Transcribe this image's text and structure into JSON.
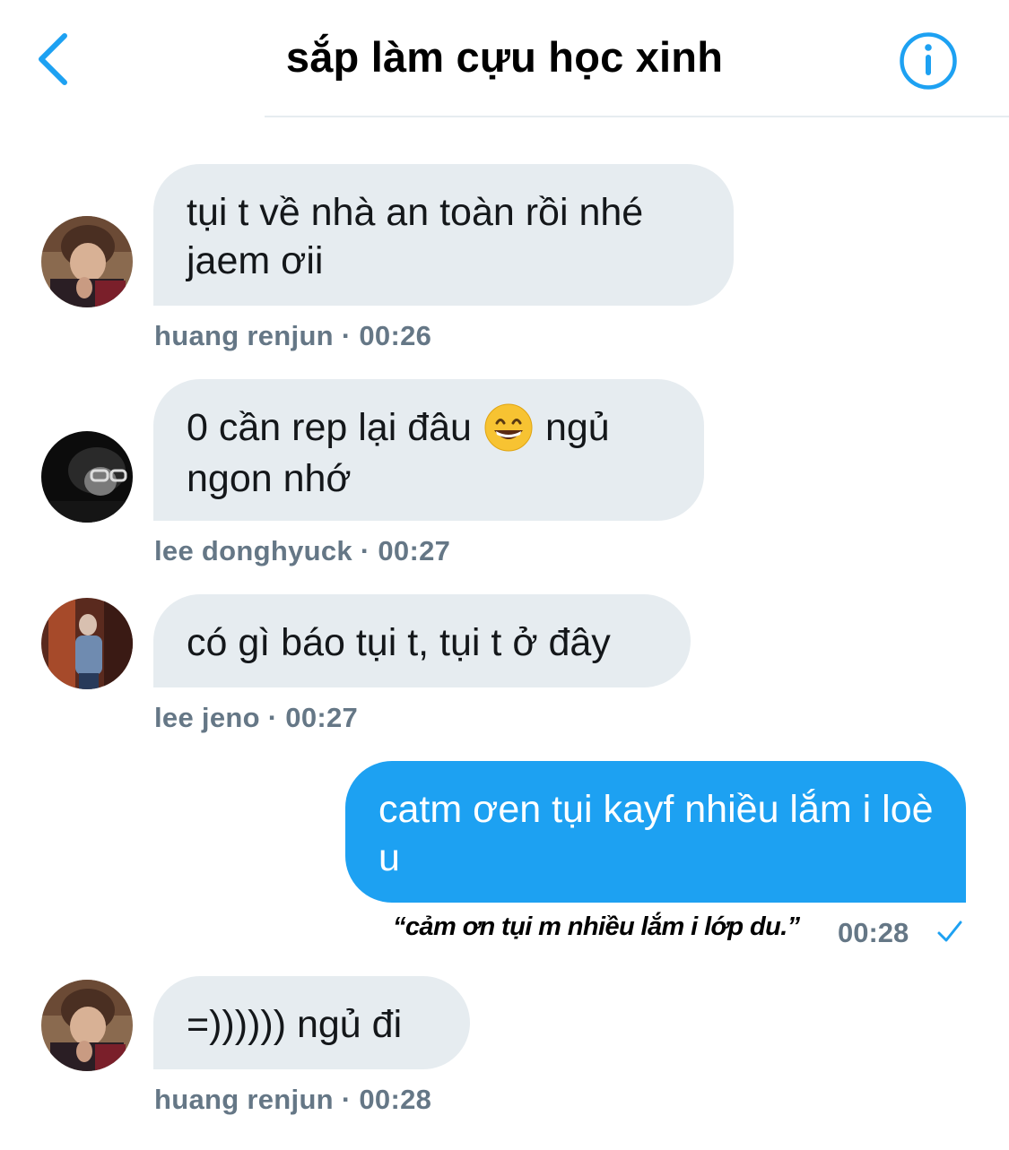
{
  "header": {
    "title": "sắp làm cựu học xinh",
    "back_icon": "chevron-left-icon",
    "info_icon": "info-circle-icon",
    "accent_color": "#1da1f2"
  },
  "messages": [
    {
      "direction": "incoming",
      "text": "tụi t về nhà an toàn rồi nhé jaem ơii",
      "sender": "huang renjun",
      "time": "00:26",
      "meta": "huang renjun · 00:26"
    },
    {
      "direction": "incoming",
      "text_before": "0 cần rep lại đâu",
      "emoji": "grinning-face-with-smiling-eyes-emoji",
      "text_after": "ngủ ngon nhớ",
      "sender": "lee donghyuck",
      "time": "00:27",
      "meta": "lee donghyuck · 00:27"
    },
    {
      "direction": "incoming",
      "text": "có gì báo tụi t, tụi t ở đây",
      "sender": "lee jeno",
      "time": "00:27",
      "meta": "lee jeno · 00:27"
    },
    {
      "direction": "outgoing",
      "text": "catm ơen tụi kayf nhiều lắm i loè u",
      "caption": "“cảm ơn tụi m nhiều lắm i lớp du.”",
      "time": "00:28",
      "status_icon": "checkmark-icon"
    },
    {
      "direction": "incoming",
      "text": "=)))))) ngủ đi",
      "sender": "huang renjun",
      "time": "00:28",
      "meta": "huang renjun · 00:28"
    }
  ],
  "colors": {
    "incoming_bubble": "#e6ecf0",
    "outgoing_bubble": "#1da1f2",
    "meta_text": "#657786"
  }
}
